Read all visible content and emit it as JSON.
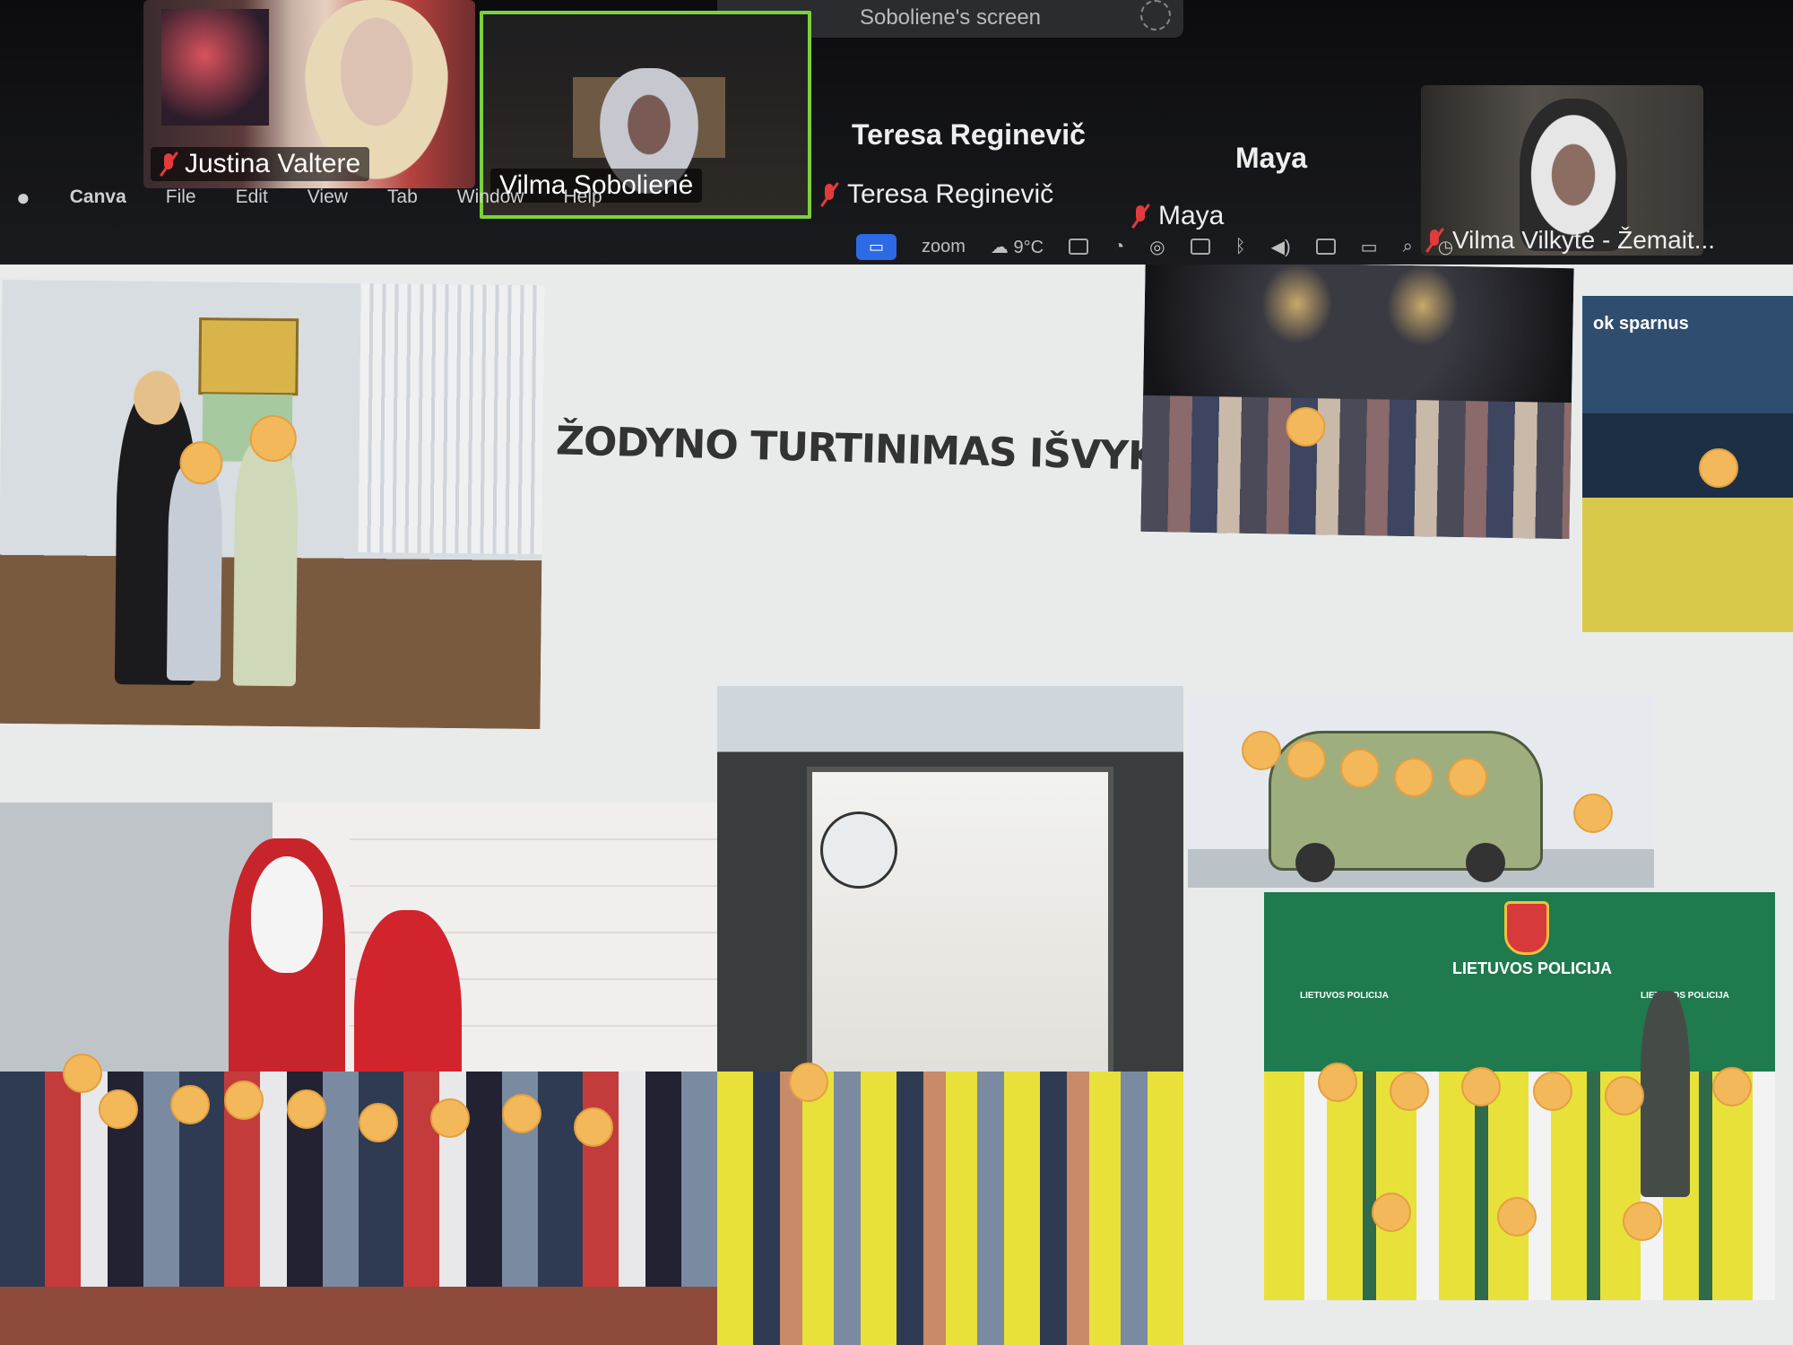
{
  "zoom": {
    "share_banner": "Soboliene's screen",
    "participants": [
      {
        "name": "Justina Valtere",
        "muted": true
      },
      {
        "name": "Vilma Sobolienė",
        "muted": false,
        "active_speaker": true
      },
      {
        "name": "Teresa Reginevič",
        "muted": true
      },
      {
        "name": "Maya",
        "muted": true
      },
      {
        "name": "Vilma Vilkytė - Žemait...",
        "muted": true
      }
    ]
  },
  "menubar": {
    "app": "Canva",
    "items": [
      "File",
      "Edit",
      "View",
      "Tab",
      "Window",
      "Help"
    ]
  },
  "statusbar": {
    "zoom_label": "zoom",
    "weather": "9°C"
  },
  "slide": {
    "title": "ŽODYNO TURTINIMAS IŠVYKŲ METU",
    "police_banner": "LIETUVOS POLICIJA",
    "police_small": "LIETUVOS POLICIJA",
    "museum_banner": "ok sparnus"
  },
  "colors": {
    "police_green": "#1f7a4d",
    "vest_yellow": "#e8e13a",
    "santa_red": "#c8242b",
    "active_speaker": "#7bd13a"
  }
}
